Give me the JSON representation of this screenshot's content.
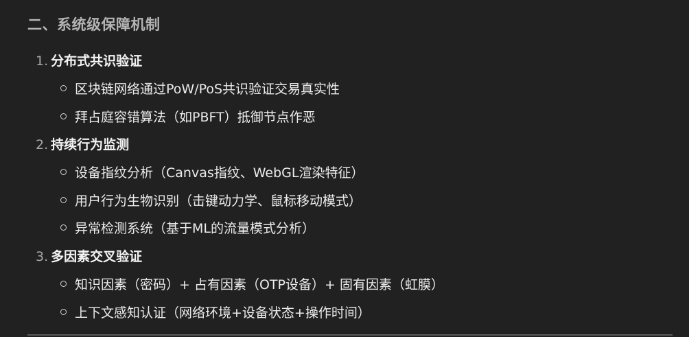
{
  "heading": "二、系统级保障机制",
  "sections": [
    {
      "number": "1.",
      "title": "分布式共识验证",
      "bullets": [
        "区块链网络通过PoW/PoS共识验证交易真实性",
        "拜占庭容错算法（如PBFT）抵御节点作恶"
      ]
    },
    {
      "number": "2.",
      "title": "持续行为监测",
      "bullets": [
        "设备指纹分析（Canvas指纹、WebGL渲染特征）",
        "用户行为生物识别（击键动力学、鼠标移动模式）",
        "异常检测系统（基于ML的流量模式分析）"
      ]
    },
    {
      "number": "3.",
      "title": "多因素交叉验证",
      "bullets": [
        "知识因素（密码）+ 占有因素（OTP设备）+ 固有因素（虹膜）",
        "上下文感知认证（网络环境+设备状态+操作时间）"
      ]
    }
  ]
}
